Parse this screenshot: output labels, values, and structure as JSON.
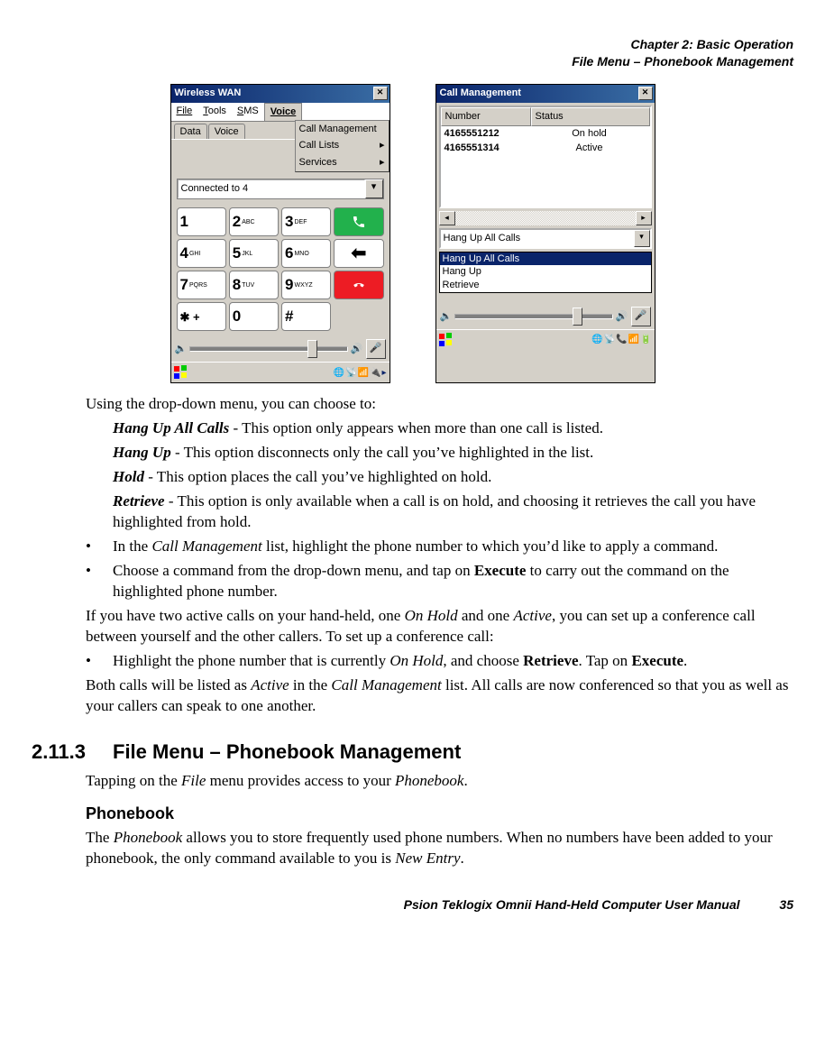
{
  "header": {
    "chapter": "Chapter 2: Basic Operation",
    "section": "File Menu – Phonebook Management"
  },
  "fig_left": {
    "title": "Wireless WAN",
    "menu": {
      "file": "File",
      "tools": "Tools",
      "sms": "SMS",
      "voice": "Voice"
    },
    "tabs": {
      "data": "Data",
      "voice": "Voice"
    },
    "voice_menu": {
      "cm": "Call Management",
      "cl": "Call Lists",
      "sv": "Services"
    },
    "status": "Connected to 4",
    "keys": {
      "k1": "1",
      "k2": "2",
      "k2l": "ABC",
      "k3": "3",
      "k3l": "DEF",
      "k4": "4",
      "k4l": "GHI",
      "k5": "5",
      "k5l": "JKL",
      "k6": "6",
      "k6l": "MNO",
      "k7": "7",
      "k7l": "PQRS",
      "k8": "8",
      "k8l": "TUV",
      "k9": "9",
      "k9l": "WXYZ",
      "kstar": "✱ +",
      "k0": "0",
      "khash": "#"
    }
  },
  "fig_right": {
    "title": "Call Management",
    "cols": {
      "num": "Number",
      "stat": "Status"
    },
    "rows": [
      {
        "num": "4165551212",
        "stat": "On hold"
      },
      {
        "num": "4165551314",
        "stat": "Active"
      }
    ],
    "combo_val": "Hang Up All Calls",
    "combo_list": [
      "Hang Up All Calls",
      "Hang Up",
      "Retrieve"
    ]
  },
  "body": {
    "intro": "Using the drop-down menu, you can choose to:",
    "opts": {
      "hua": {
        "b": "Hang Up All Calls",
        "t": " - This option only appears when more than one call is listed."
      },
      "hu": {
        "b": "Hang Up",
        "t": " - This option disconnects only the call you’ve highlighted in the list."
      },
      "ho": {
        "b": "Hold",
        "t": " - This option places the call you’ve highlighted on hold."
      },
      "re": {
        "b": "Retrieve",
        "t": " - This option is only available when a call is on hold, and choosing it retrieves the call you have highlighted from hold."
      }
    },
    "b1a": "In the ",
    "b1b": "Call Management",
    "b1c": " list, highlight the phone number to which you’d like to apply a command.",
    "b2a": "Choose a command from the drop-down menu, and tap on ",
    "b2b": "Execute",
    "b2c": " to carry out the command on the highlighted phone number.",
    "p2a": "If you have two active calls on your hand-held, one ",
    "p2b": "On Hold",
    "p2c": " and one ",
    "p2d": "Active",
    "p2e": ", you can set up a conference call between yourself and the other callers. To set up a conference call:",
    "b3a": "Highlight the phone number that is currently ",
    "b3b": "On Hold",
    "b3c": ", and choose ",
    "b3d": "Retrieve",
    "b3e": ". Tap on ",
    "b3f": "Execute",
    "b3g": ".",
    "p3a": "Both calls will be listed as ",
    "p3b": "Active",
    "p3c": " in the ",
    "p3d": "Call Management",
    "p3e": " list. All calls are now conferenced so that you as well as your callers can speak to one another."
  },
  "section": {
    "num": "2.11.3",
    "title": "File Menu – Phonebook Management",
    "p1a": "Tapping on the ",
    "p1b": "File",
    "p1c": " menu provides access to your ",
    "p1d": "Phonebook",
    "p1e": ".",
    "sub": "Phonebook",
    "p2a": "The ",
    "p2b": "Phonebook",
    "p2c": " allows you to store frequently used phone numbers. When no numbers have been added to your phonebook, the only command available to you is ",
    "p2d": "New Entry",
    "p2e": "."
  },
  "footer": {
    "text": "Psion Teklogix Omnii Hand-Held Computer User Manual",
    "page": "35"
  }
}
